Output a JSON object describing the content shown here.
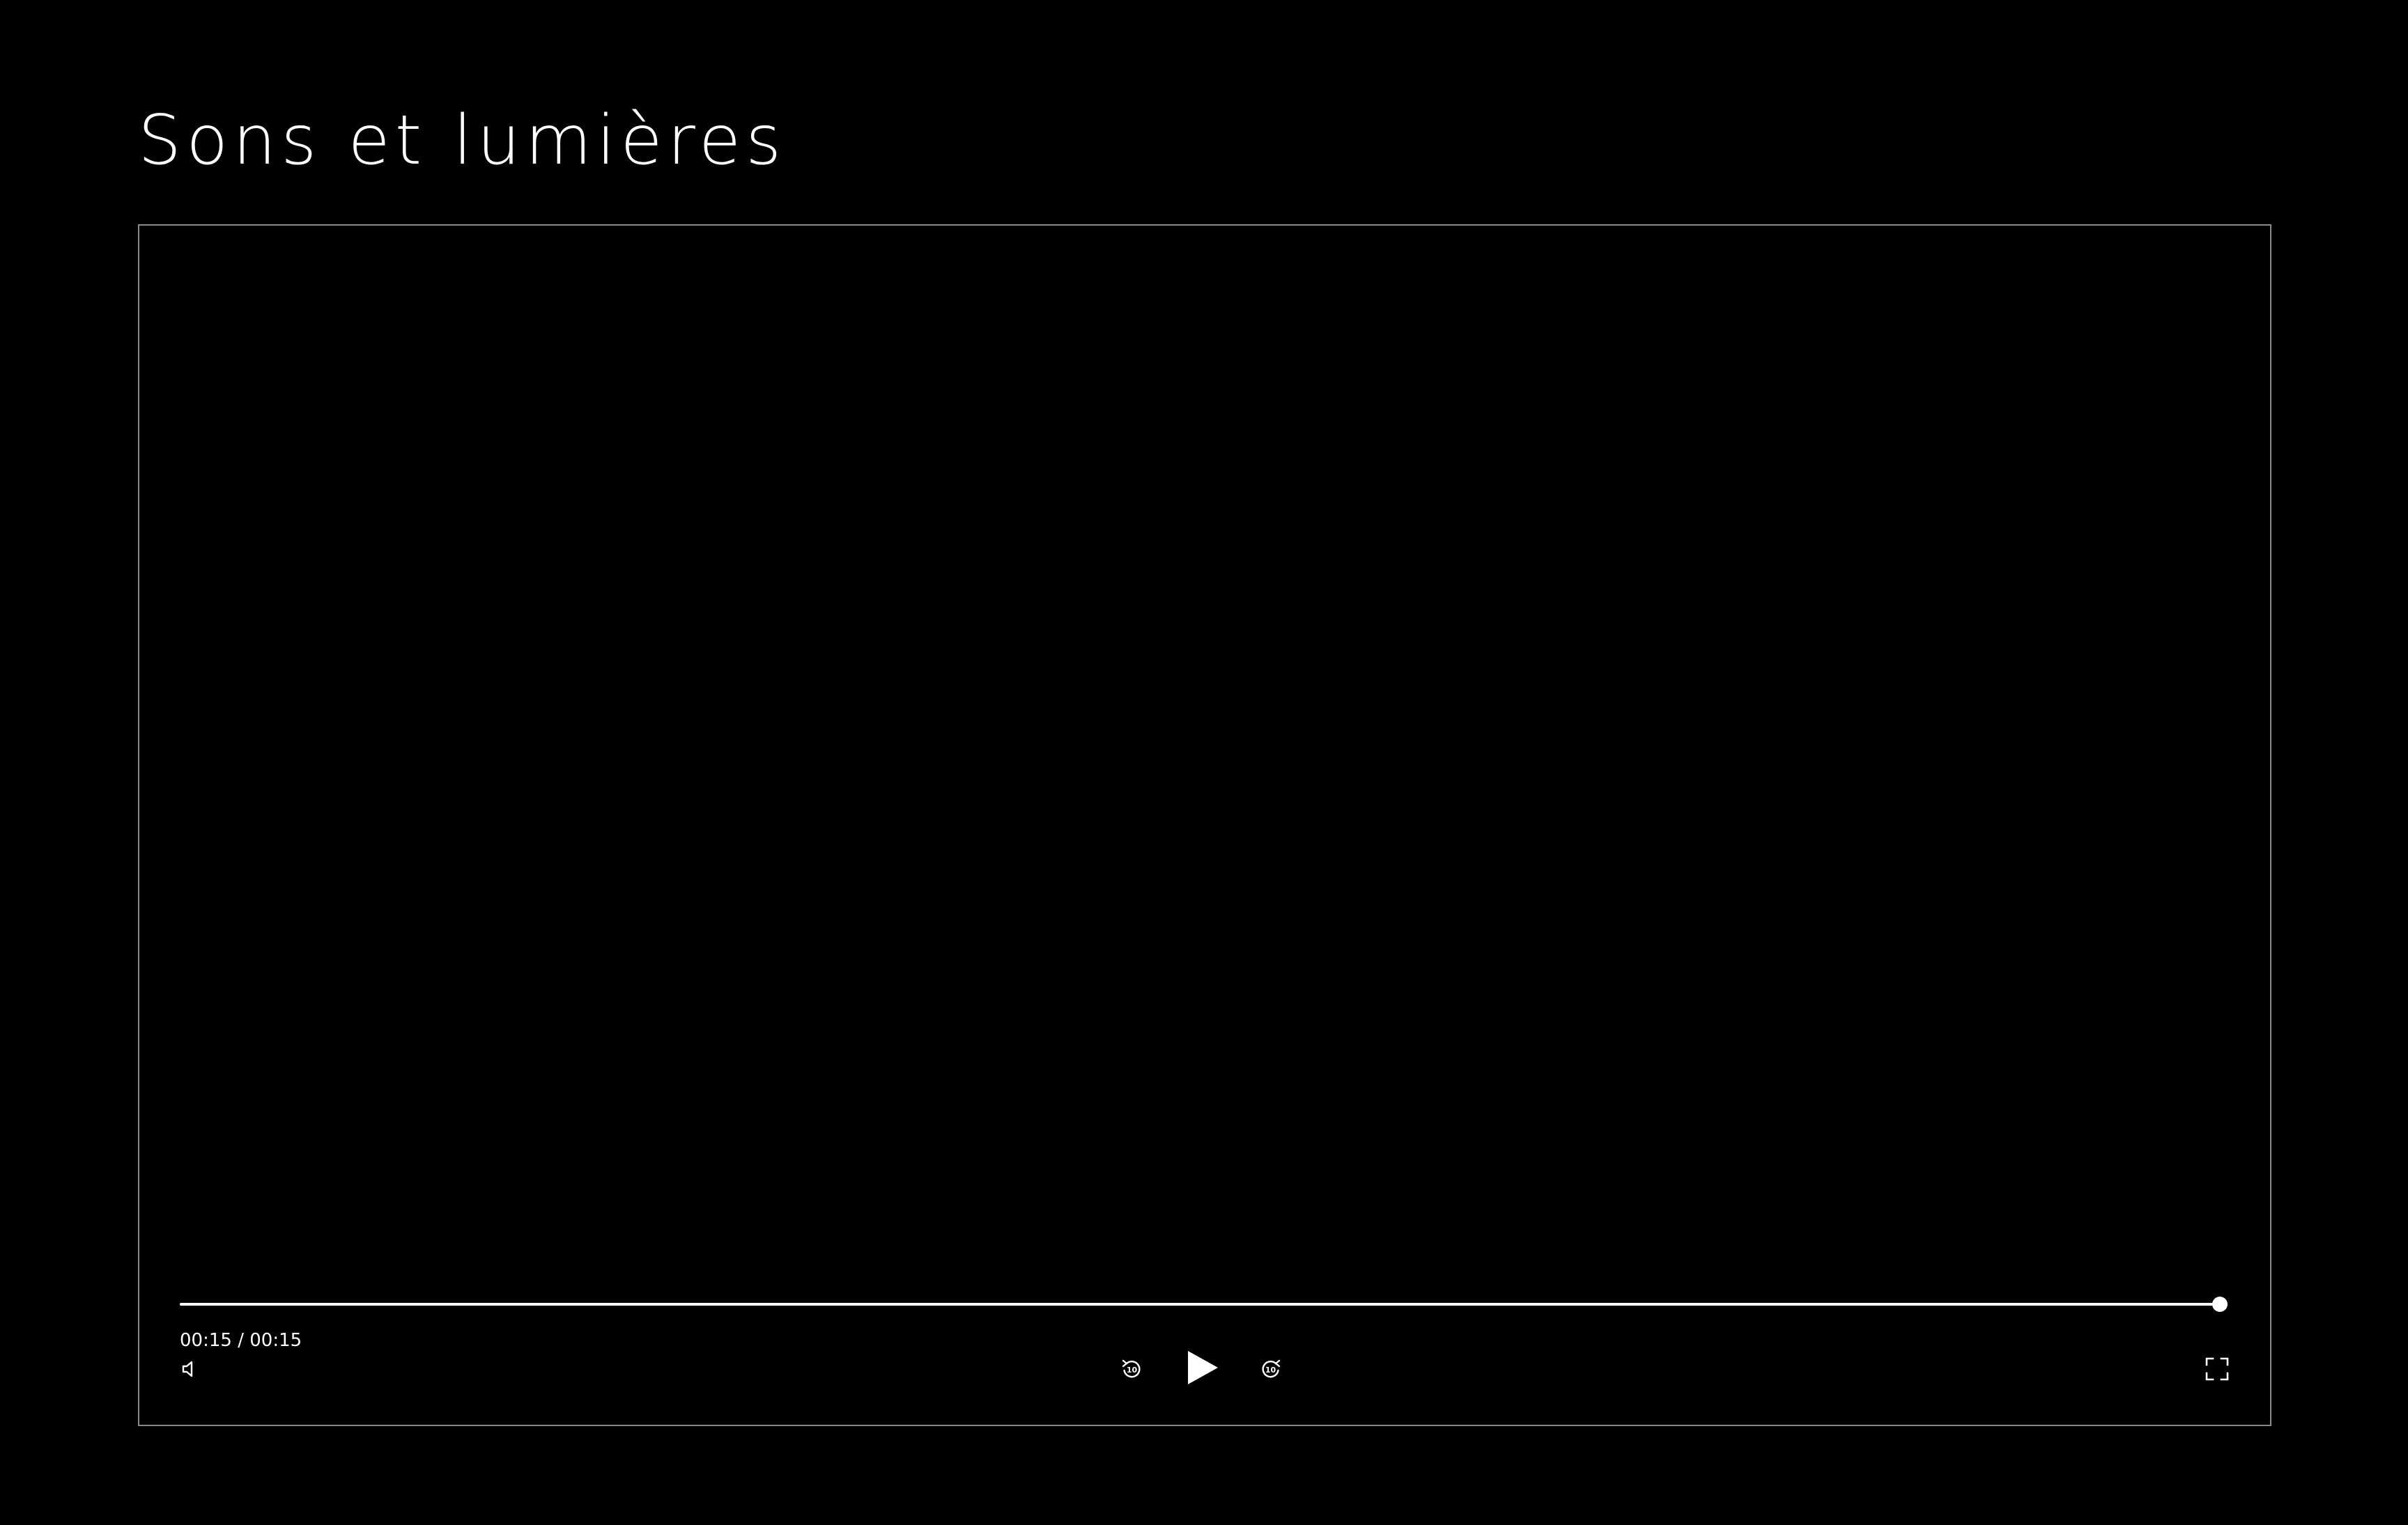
{
  "page": {
    "title": "Sons et lumières"
  },
  "player": {
    "current_time": "00:15",
    "separator": " / ",
    "duration": "00:15",
    "progress_fraction": 1.0,
    "state": "paused",
    "muted": true,
    "skip_back_seconds": "10",
    "skip_forward_seconds": "10",
    "controls": {
      "mute_icon": "speaker-muted-icon",
      "skip_back_icon": "rewind-10-icon",
      "play_icon": "play-icon",
      "skip_forward_icon": "forward-10-icon",
      "fullscreen_icon": "fullscreen-icon"
    }
  },
  "colors": {
    "background": "#000000",
    "foreground": "#ffffff",
    "border": "#8a8a8a"
  }
}
